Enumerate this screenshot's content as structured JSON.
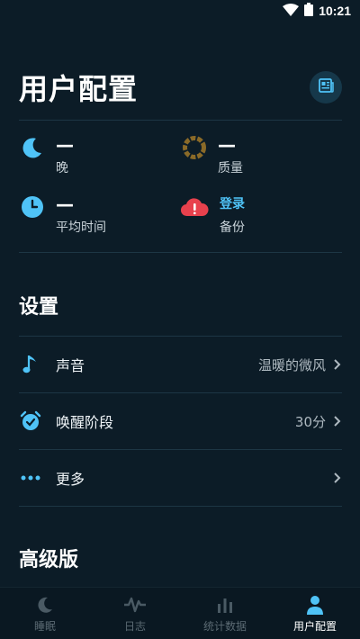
{
  "status": {
    "time": "10:21"
  },
  "header": {
    "title": "用户配置"
  },
  "stats": {
    "night": {
      "value": "—",
      "label": "晚"
    },
    "quality": {
      "value": "—",
      "label": "质量"
    },
    "avg_time": {
      "value": "—",
      "label": "平均时间"
    },
    "backup": {
      "value": "登录",
      "label": "备份"
    }
  },
  "settings": {
    "title": "设置",
    "sound": {
      "label": "声音",
      "value": "温暖的微风"
    },
    "wake": {
      "label": "唤醒阶段",
      "value": "30分"
    },
    "more": {
      "label": "更多"
    }
  },
  "premium": {
    "title": "高级版"
  },
  "nav": [
    {
      "label": "睡眠"
    },
    {
      "label": "日志"
    },
    {
      "label": "统计数据"
    },
    {
      "label": "用户配置"
    }
  ],
  "colors": {
    "background": "#0c1c27",
    "accent": "#4fc3f7",
    "cloud": "#e8414d",
    "quality_ring": "#8a6a28"
  }
}
